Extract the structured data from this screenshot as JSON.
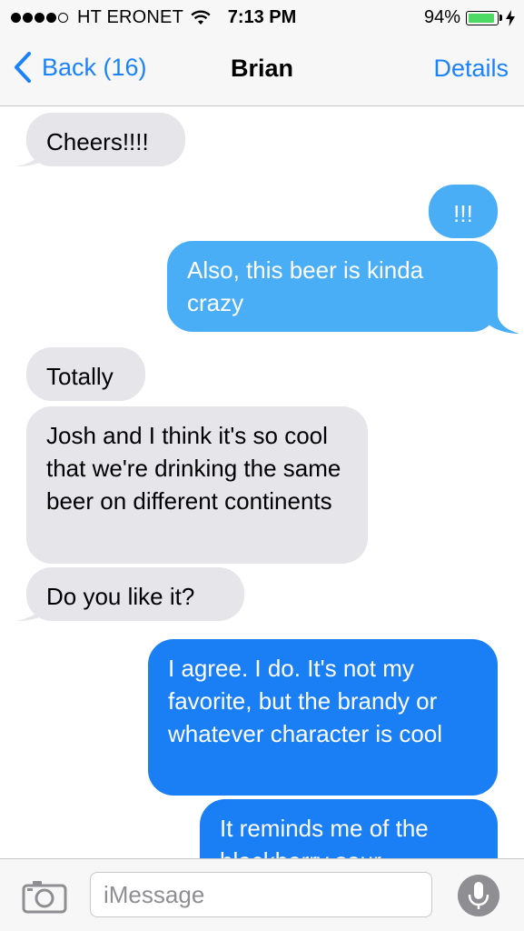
{
  "status_bar": {
    "carrier": "HT ERONET",
    "time": "7:13 PM",
    "battery_percent": "94%",
    "battery_level": 0.94,
    "signal_bars_filled": 4,
    "signal_bars_total": 5,
    "battery_color": "#4cd964"
  },
  "nav": {
    "back_label": "Back (16)",
    "title": "Brian",
    "details_label": "Details"
  },
  "messages": [
    {
      "direction": "incoming",
      "text": "Cheers!!!!"
    },
    {
      "direction": "outgoing",
      "text": "!!!"
    },
    {
      "direction": "outgoing",
      "text": "Also, this beer is kinda crazy"
    },
    {
      "direction": "incoming",
      "text": "Totally"
    },
    {
      "direction": "incoming",
      "text": "Josh and I think it's so cool that we're drinking the same beer on different continents"
    },
    {
      "direction": "incoming",
      "text": "Do you like it?"
    },
    {
      "direction": "outgoing",
      "text": "I agree. I do. It's not my favorite, but the brandy or whatever character is cool"
    },
    {
      "direction": "outgoing",
      "text": "It reminds me of the blackberry sour"
    }
  ],
  "input": {
    "placeholder": "iMessage",
    "value": ""
  },
  "icons": {
    "back": "chevron-left-icon",
    "camera": "camera-icon",
    "mic": "microphone-icon"
  },
  "colors": {
    "accent": "#1a82fb",
    "incoming_bubble": "#e5e5ea",
    "outgoing_bubble_light": "#4aaef6",
    "outgoing_bubble_dark": "#1a7ff5"
  }
}
